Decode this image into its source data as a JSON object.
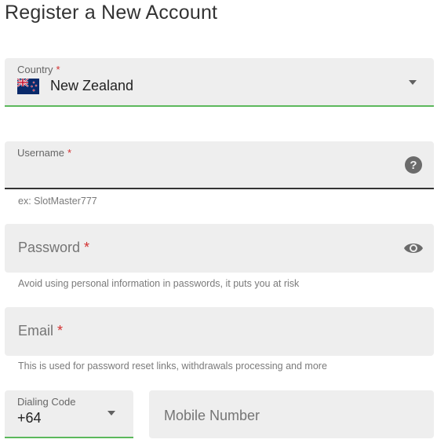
{
  "page": {
    "title": "Register a New Account"
  },
  "country": {
    "label": "Country",
    "required_mark": "*",
    "value": "New Zealand",
    "flag_icon": "new-zealand-flag-icon",
    "dropdown_icon": "chevron-down-icon"
  },
  "username": {
    "label": "Username",
    "required_mark": "*",
    "value": "",
    "help_icon": "question-mark-icon",
    "helper": "ex: SlotMaster777"
  },
  "password": {
    "label": "Password",
    "required_mark": "*",
    "value": "",
    "visibility_icon": "eye-icon",
    "helper": "Avoid using personal information in passwords, it puts you at risk"
  },
  "email": {
    "label": "Email",
    "required_mark": "*",
    "value": "",
    "helper": "This is used for password reset links, withdrawals processing and more"
  },
  "dialing_code": {
    "label": "Dialing Code",
    "value": "+64",
    "dropdown_icon": "chevron-down-icon"
  },
  "mobile": {
    "placeholder": "Mobile Number",
    "value": ""
  },
  "colors": {
    "field_bg": "#eeeeee",
    "focus_green": "#5cb85c",
    "required_red": "#d32f2f",
    "text_dark": "#333333",
    "helper_gray": "#7a7a7a"
  }
}
